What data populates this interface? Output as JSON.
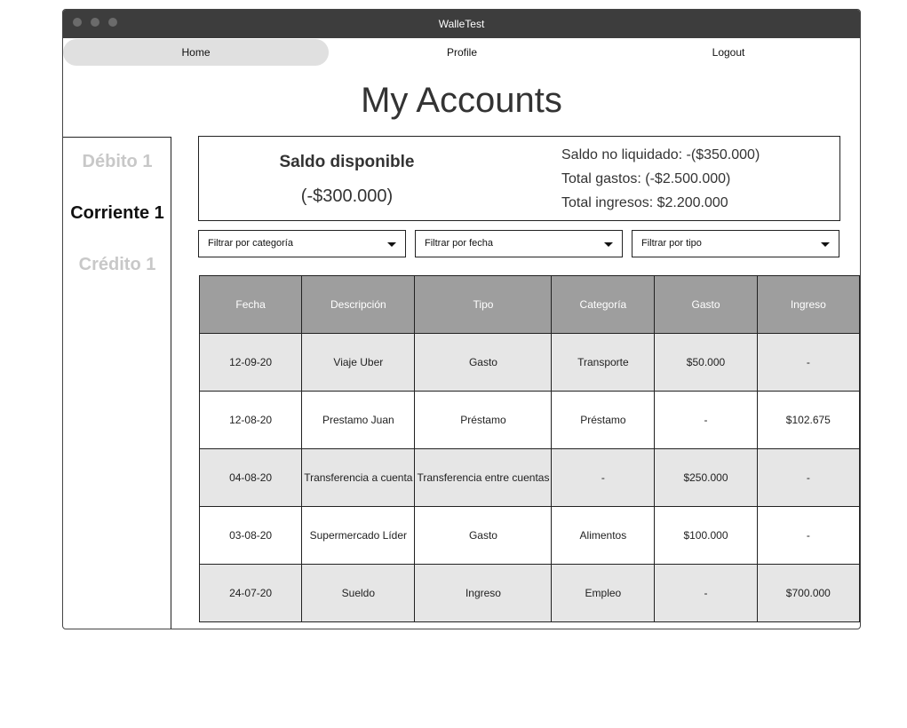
{
  "window": {
    "title": "WalleTest"
  },
  "nav": {
    "home": "Home",
    "profile": "Profile",
    "logout": "Logout"
  },
  "page": {
    "title": "My Accounts"
  },
  "sidebar": {
    "accounts": [
      "Débito 1",
      "Corriente 1",
      "Crédito 1"
    ],
    "active_index": 1
  },
  "summary": {
    "saldo_label": "Saldo disponible",
    "saldo_value": "(-$300.000)",
    "no_liquidado": "Saldo no liquidado: -($350.000)",
    "total_gastos": "Total gastos: (-$2.500.000)",
    "total_ingresos": "Total ingresos: $2.200.000"
  },
  "filters": {
    "categoria": "Filtrar por categoría",
    "fecha": "Filtrar por fecha",
    "tipo": "Filtrar por tipo"
  },
  "table": {
    "headers": [
      "Fecha",
      "Descripción",
      "Tipo",
      "Categoría",
      "Gasto",
      "Ingreso"
    ],
    "rows": [
      [
        "12-09-20",
        "Viaje Uber",
        "Gasto",
        "Transporte",
        "$50.000",
        "-"
      ],
      [
        "12-08-20",
        "Prestamo Juan",
        "Préstamo",
        "Préstamo",
        "-",
        "$102.675"
      ],
      [
        "04-08-20",
        "Transferencia a cuenta",
        "Transferencia entre cuentas",
        "-",
        "$250.000",
        "-"
      ],
      [
        "03-08-20",
        "Supermercado Líder",
        "Gasto",
        "Alimentos",
        "$100.000",
        "-"
      ],
      [
        "24-07-20",
        "Sueldo",
        "Ingreso",
        "Empleo",
        "-",
        "$700.000"
      ]
    ]
  },
  "colors": {
    "titlebar": "#3d3d3d",
    "header": "#9e9e9e",
    "shade": "#e6e6e6",
    "active_nav": "#e0e0e0"
  }
}
